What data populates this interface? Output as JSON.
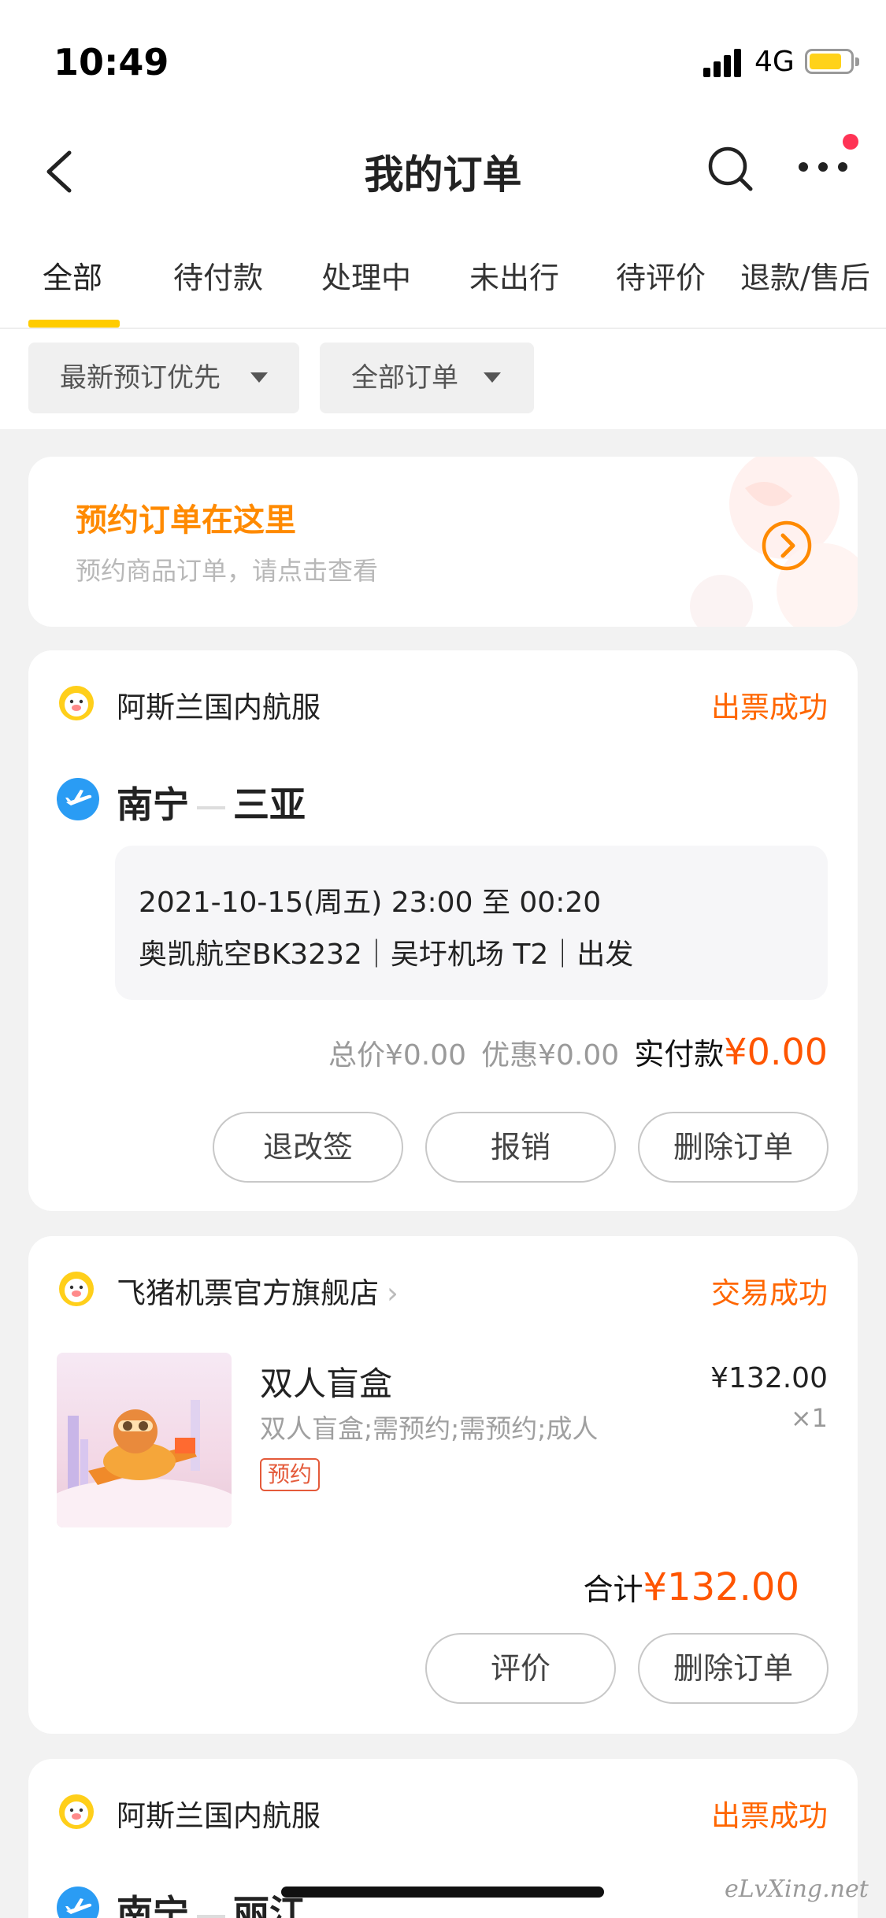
{
  "status_bar": {
    "time": "10:49",
    "network": "4G"
  },
  "nav": {
    "title": "我的订单"
  },
  "tabs": [
    {
      "label": "全部",
      "active": true
    },
    {
      "label": "待付款"
    },
    {
      "label": "处理中"
    },
    {
      "label": "未出行"
    },
    {
      "label": "待评价"
    },
    {
      "label": "退款/售后"
    }
  ],
  "filters": [
    {
      "label": "最新预订优先"
    },
    {
      "label": "全部订单"
    }
  ],
  "promo": {
    "title": "预约订单在这里",
    "subtitle": "预约商品订单，请点击查看"
  },
  "orders": [
    {
      "shop": "阿斯兰国内航服",
      "status": "出票成功",
      "from": "南宁",
      "to": "三亚",
      "line1": "2021-10-15(周五) 23:00 至 00:20",
      "line2": "奥凯航空BK3232｜吴圩机场 T2｜出发",
      "total": "总价¥0.00",
      "discount": "优惠¥0.00",
      "paid_label": "实付款",
      "paid_amount": "¥0.00",
      "buttons": [
        "退改签",
        "报销",
        "删除订单"
      ]
    },
    {
      "shop": "飞猪机票官方旗舰店",
      "status": "交易成功",
      "product_name": "双人盲盒",
      "product_desc": "双人盲盒;需预约;需预约;成人",
      "tag": "预约",
      "price": "¥132.00",
      "qty": "×1",
      "total_label": "合计",
      "total_amount": "¥132.00",
      "buttons": [
        "评价",
        "删除订单"
      ]
    },
    {
      "shop": "阿斯兰国内航服",
      "status": "出票成功",
      "from": "南宁",
      "to": "丽江"
    }
  ],
  "watermark": "eLvXing.net",
  "colors": {
    "accent": "#ffcc00",
    "status": "#ff6600",
    "price": "#ff5500",
    "promo": "#ff8a00",
    "badge": "#ff3355"
  }
}
